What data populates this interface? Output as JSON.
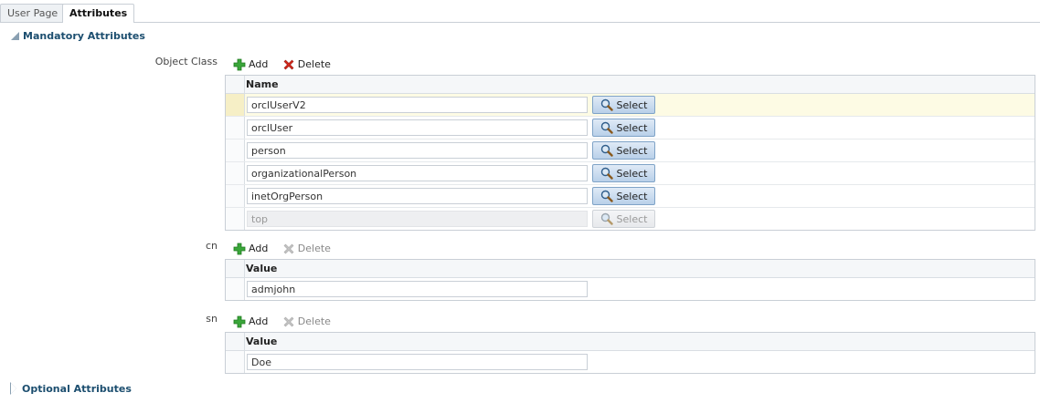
{
  "tabs": [
    "User Page",
    "Attributes"
  ],
  "sections": {
    "mandatory": "Mandatory Attributes",
    "optional": "Optional Attributes"
  },
  "toolbar": {
    "add_label": "Add",
    "delete_label": "Delete"
  },
  "object_class": {
    "label": "Object Class",
    "column": "Name",
    "select_label": "Select",
    "rows": [
      "orclUserV2",
      "orclUser",
      "person",
      "organizationalPerson",
      "inetOrgPerson",
      "top"
    ]
  },
  "cn": {
    "label": "cn",
    "column": "Value",
    "rows": [
      "admjohn"
    ]
  },
  "sn": {
    "label": "sn",
    "column": "Value",
    "rows": [
      "Doe"
    ]
  },
  "icons": {
    "add": "plus-icon",
    "delete": "x-icon",
    "select": "magnifier-icon",
    "expanded": "triangle-expanded-icon",
    "collapsed": "triangle-collapsed-icon"
  },
  "colors": {
    "header_text": "#1c4e6f",
    "add_green": "#3aa63a",
    "delete_red": "#d42a1e",
    "selected_row": "#fdfbe4"
  }
}
